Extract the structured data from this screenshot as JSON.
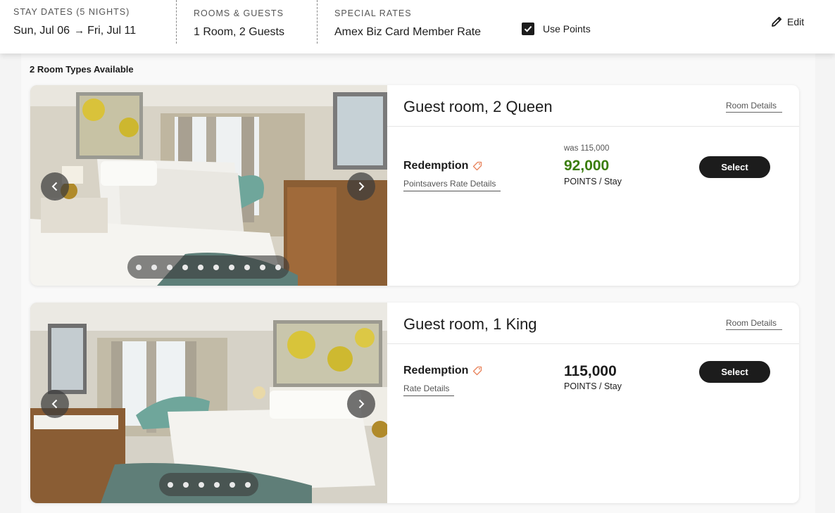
{
  "header": {
    "stay_label": "STAY DATES (5 NIGHTS)",
    "check_in": "Sun, Jul 06",
    "check_out": "Fri, Jul 11",
    "rooms_label": "ROOMS & GUESTS",
    "rooms_value": "1 Room, 2 Guests",
    "rates_label": "SPECIAL RATES",
    "rates_value": "Amex Biz Card Member Rate",
    "use_points_label": "Use Points",
    "use_points_checked": true,
    "edit_label": "Edit"
  },
  "results": {
    "count_text": "2 Room Types Available"
  },
  "rooms": [
    {
      "title": "Guest room, 2 Queen",
      "details_link": "Room Details",
      "rate_name": "Redemption",
      "rate_link": "Pointsavers Rate Details",
      "was_price": "was 115,000",
      "price": "92,000",
      "unit_strong": "POINTS",
      "unit_rest": " / Stay",
      "select_label": "Select",
      "photo_count": 10
    },
    {
      "title": "Guest room, 1 King",
      "details_link": "Room Details",
      "rate_name": "Redemption",
      "rate_link": "Rate Details",
      "price": "115,000",
      "unit_strong": "POINTS",
      "unit_rest": " / Stay",
      "select_label": "Select",
      "photo_count": 6
    }
  ],
  "colors": {
    "accent_dark": "#1c1c1c",
    "discount_green": "#3a7d0a",
    "tag_orange": "#e8825a"
  }
}
